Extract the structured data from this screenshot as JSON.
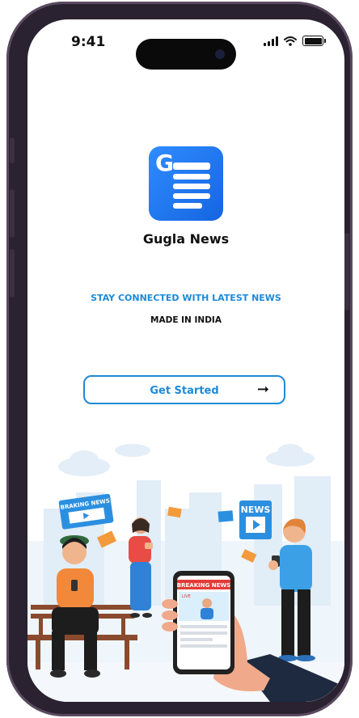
{
  "status_bar": {
    "time": "9:41"
  },
  "app": {
    "name": "Gugla News",
    "logo_letter": "G",
    "tagline": "STAY CONNECTED WITH LATEST NEWS",
    "made_in": "MADE IN INDIA"
  },
  "cta": {
    "label": "Get Started",
    "arrow": "➞"
  },
  "illustration": {
    "sign_breaking": "BRAKING NEWS",
    "sign_news": "NEWS",
    "phone_banner": "BREAKING NEWS",
    "phone_live": "LIVE"
  },
  "colors": {
    "accent": "#1c8ad8",
    "logo_blue": "#1f77f0"
  }
}
